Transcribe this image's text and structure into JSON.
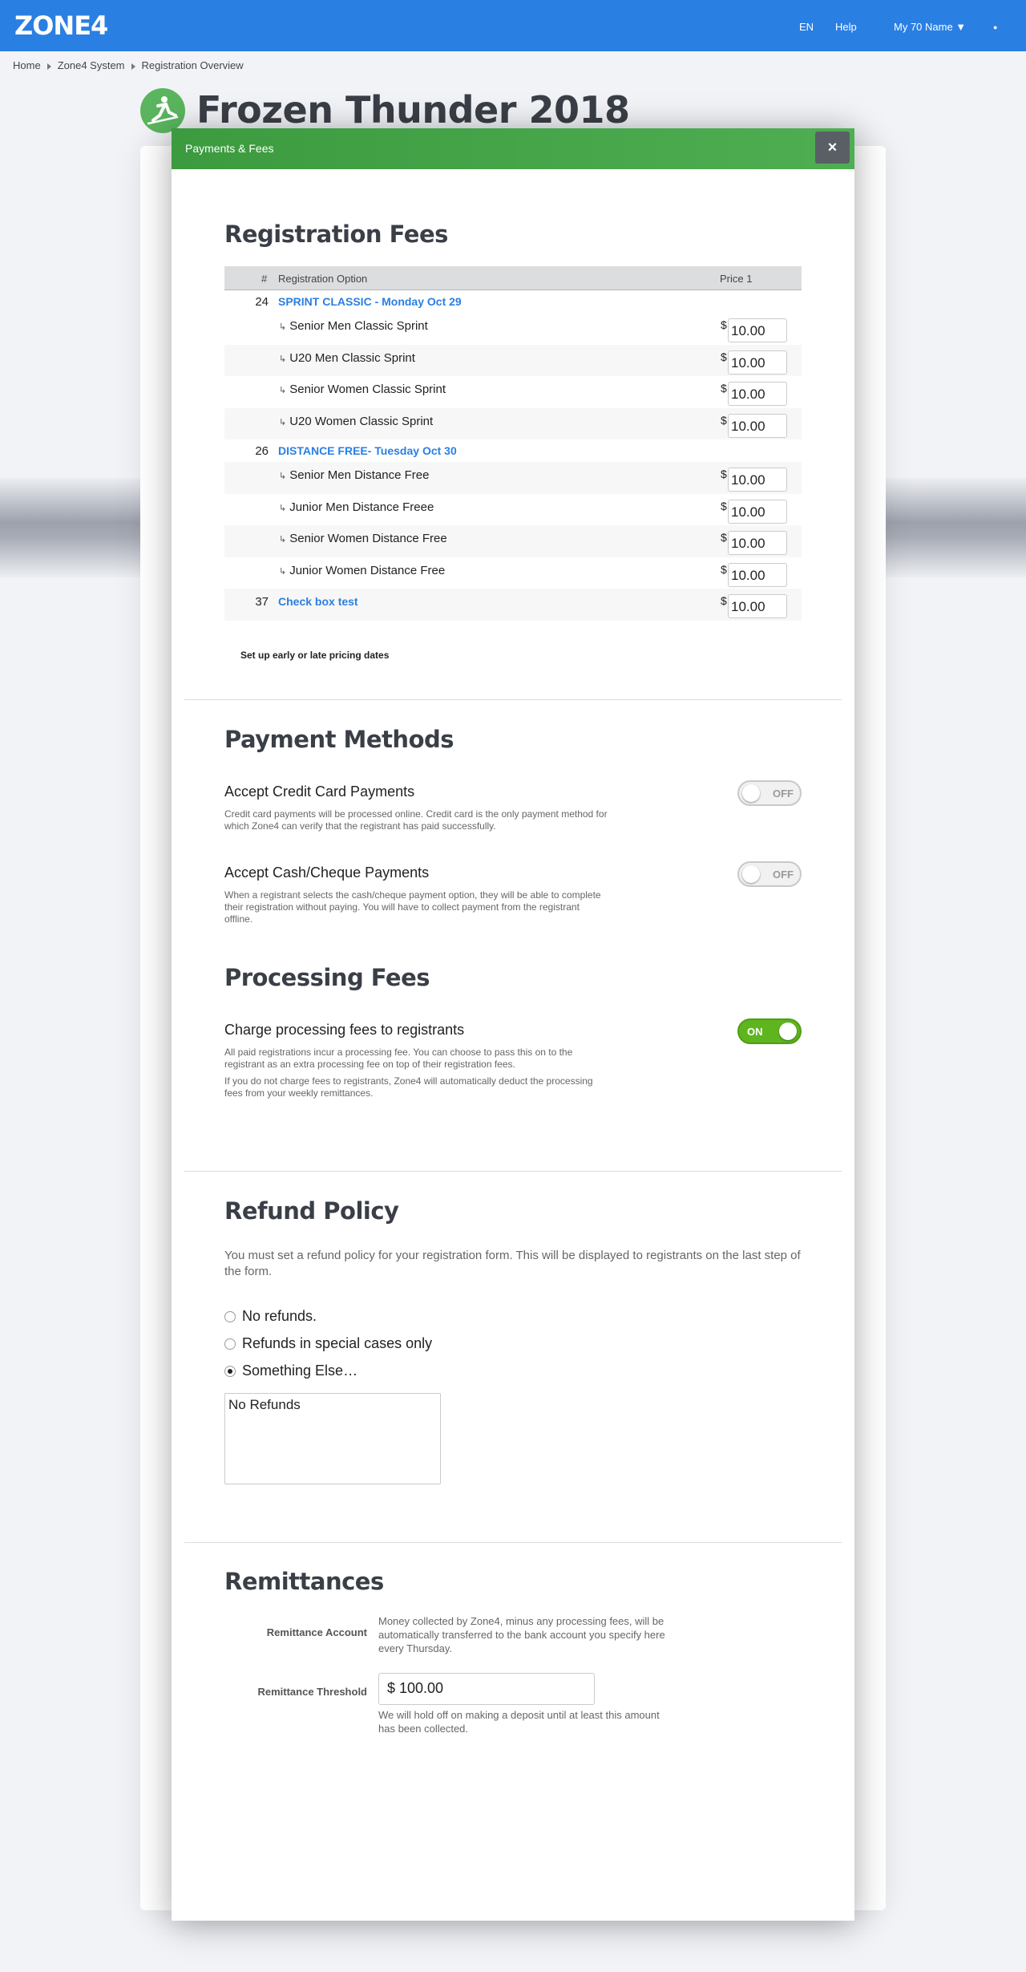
{
  "topbar": {
    "logo": "ZONE4",
    "lang": "EN",
    "help": "Help",
    "account": "My 70 Name ▼",
    "dot": "●"
  },
  "breadcrumb": [
    "Home",
    "Zone4 System",
    "Registration Overview"
  ],
  "page": {
    "title": "Frozen Thunder 2018"
  },
  "modal": {
    "title": "Payments & Fees",
    "close": "×"
  },
  "fees": {
    "heading": "Registration Fees",
    "columns": {
      "num": "#",
      "option": "Registration Option",
      "price": "Price 1"
    },
    "currency": "$",
    "groups": [
      {
        "num": "24",
        "name": "SPRINT CLASSIC - Monday Oct 29",
        "options": [
          {
            "name": "Senior Men Classic Sprint",
            "price": "10.00"
          },
          {
            "name": "U20 Men Classic Sprint",
            "price": "10.00"
          },
          {
            "name": "Senior Women Classic Sprint",
            "price": "10.00"
          },
          {
            "name": "U20 Women Classic Sprint",
            "price": "10.00"
          }
        ]
      },
      {
        "num": "26",
        "name": "DISTANCE FREE- Tuesday Oct 30",
        "options": [
          {
            "name": "Senior Men Distance Free",
            "price": "10.00"
          },
          {
            "name": "Junior Men Distance Freee",
            "price": "10.00"
          },
          {
            "name": "Senior Women Distance Free",
            "price": "10.00"
          },
          {
            "name": "Junior Women Distance Free",
            "price": "10.00"
          }
        ]
      }
    ],
    "checkbox_test": {
      "num": "37",
      "name": "Check box test",
      "price": "10.00"
    },
    "arrow": "↳",
    "early_link": "Set up early or late pricing dates"
  },
  "payment_methods": {
    "heading": "Payment Methods",
    "credit": {
      "title": "Accept Credit Card Payments",
      "desc": "Credit card payments will be processed online. Credit card is the only payment method for which Zone4 can verify that the registrant has paid successfully.",
      "state": "OFF"
    },
    "cash": {
      "title": "Accept Cash/Cheque Payments",
      "desc": "When a registrant selects the cash/cheque payment option, they will be able to complete their registration without paying. You will have to collect payment from the registrant offline.",
      "state": "OFF"
    }
  },
  "processing": {
    "heading": "Processing Fees",
    "title": "Charge processing fees to registrants",
    "desc1": "All paid registrations incur a processing fee. You can choose to pass this on to the registrant as an extra processing fee on top of their registration fees.",
    "desc2": "If you do not charge fees to registrants, Zone4 will automatically deduct the processing fees from your weekly remittances.",
    "state": "ON"
  },
  "refund": {
    "heading": "Refund Policy",
    "desc": "You must set a refund policy for your registration form. This will be displayed to registrants on the last step of the form.",
    "options": [
      "No refunds.",
      "Refunds in special cases only",
      "Something Else…"
    ],
    "selected_index": 2,
    "text": "No Refunds"
  },
  "remittances": {
    "heading": "Remittances",
    "account_label": "Remittance Account",
    "account_desc": "Money collected by Zone4, minus any processing fees, will be automatically transferred to the bank account you specify here every Thursday.",
    "threshold_label": "Remittance Threshold",
    "threshold_value": "$  100.00",
    "threshold_desc": "We will hold off on making a deposit until at least this amount has been collected."
  },
  "colors": {
    "accent": "#2a7fe2",
    "modal_header": "#4caf50",
    "toggle_on": "#5fb520"
  }
}
